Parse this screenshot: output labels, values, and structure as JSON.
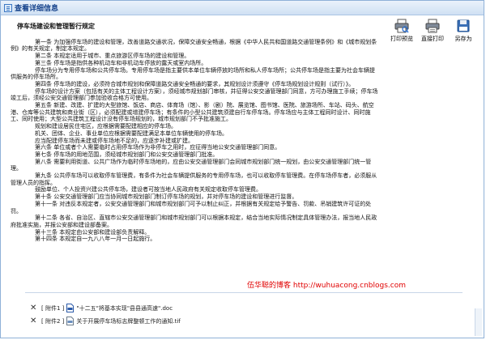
{
  "window": {
    "title": "查看详细信息"
  },
  "toolbar": {
    "print_preview": "打印预览",
    "direct_print": "直接打印",
    "save_as": "另存为"
  },
  "document": {
    "title": "停车场建设和管理暂行规定",
    "paragraphs": [
      "第一条 为加强停车场的建设和管理，改善道路交通状况，保障交通安全畅通，根据《中华人民共和国道路交通管理条例》和《城市规划条例》的有关规定，制定本规定。",
      "第二条 本规定适用于城市、重点旅游区停车场的建设和管理。",
      "第三条 停车场是指供各种机动车和非机动车停放的露天或室内场所。",
      "停车场分为专用停车场和公共停车场。专用停车场是指主要供本单位车辆停放的场所和私人停车场所；公共停车场是指主要为社会车辆提供服务的停车场所。",
      "第四条 停车场的建设，必须符合城市规划和保障道路交通安全畅通的要求，其规划设计须遵守《停车场规划设计规则（试行）》。",
      "停车场的设计方案（包括有关的主体工程设计方案），须经城市规划部门审核，并征得公安交通管理部门同意，方可办理施工手续；停车场竣工后，须经公安交通管理部门参加验收合格方可使用。",
      "第五条 新建、改建、扩建的大型旅馆、饭店、商店、体育场（馆）、影（剧）院、展览馆、图书馆、医院、旅游场所、车站、码头、航空港、仓库等公共建筑和商业街（区），必须配建或增建停车场；有条件的小型公共建筑须建自行车停车场。停车场应与主体工程同时设计、同时施工、同时使用；大型公共建筑工程设计没有停车场规划的，城市规划部门不予批准施工。",
      "规划和建设居民住宅区，应根据需要配建相应的停车场。",
      "机关、团体、企业、事业单位应根据需要配建满足本单位车辆使用的停车场。",
      "应当配建停车场而未建或停车场地不足的，应逐步补建或扩建。",
      "第六条 单位或者个人需要临时占用停车场作为非停车之用时，应征得当地公安交通管理部门同意。",
      "第七条 停车场的用地范围，须经城市规划部门和公安交通管理部门批准。",
      "第八条 需要利用街道、公共广场作为临时停车场地的，应由公安交通管理部门会同城市规划部门统一规划，由公安交通管理部门统一管理。",
      "第九条 公共停车场可以收取停车管理费，有条件为社会车辆提供服务的专用停车场，也可以收取停车管理费。在停车场停车者，必须服从管理人员的指挥。",
      "鼓励单位、个人投资兴建公共停车场，建设者可按当地人民政府有关规定收取停车管理费。",
      "第十条 公安交通管理部门应当协同城市规划部门制订停车场的规划，并对停车场的建设和管理进行监督。",
      "第十一条 对违反本规定者，公安交通管理部门和城市规划部门可予以制止纠正，并根据有关规定给予警告、罚款、吊销建筑许可证的处罚。",
      "第十二条 各省、自治区、直辖市公安交通管理部门和城市规划部门可以根据本规定，结合当地实际情况制定具体管理办法，报当地人民政府批准实施，并报公安部和建设部备案。",
      "第十三条 本规定由公安部和建设部负责解释。",
      "第十四条 本规定自一九八八年一月一日起施行。"
    ]
  },
  "watermark": "伍华聪的博客 http://wuhuacong.cnblogs.com",
  "attachments": [
    {
      "prefix": "[ 附件1 ]",
      "name": "\"十二五\"将基本实现\"县县通高速\".doc"
    },
    {
      "prefix": "[ 附件2 ]",
      "name": "关于开展停车场标志牌整顿工作的通知.tif"
    }
  ],
  "colors": {
    "title_text": "#15428b",
    "watermark": "#e00000",
    "border": "#8fb1d8"
  },
  "icons": [
    "window-icon",
    "print-preview-icon",
    "direct-print-icon",
    "save-as-icon",
    "delete-icon",
    "doc-file-icon",
    "tif-file-icon"
  ]
}
